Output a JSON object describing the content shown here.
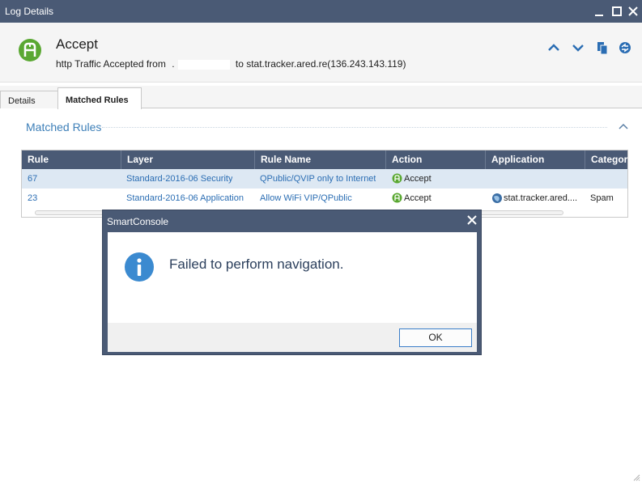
{
  "window": {
    "title": "Log Details",
    "controls": {
      "minimize": "—",
      "maximize": "▢",
      "close": "✕"
    }
  },
  "header": {
    "action_title": "Accept",
    "summary_prefix": "http Traffic Accepted from",
    "summary_source": ".",
    "summary_suffix": "to stat.tracker.ared.re(136.243.143.119)",
    "icons": [
      "accept-icon",
      "up-arrow-icon",
      "down-arrow-icon",
      "copy-icon",
      "refresh-icon"
    ]
  },
  "tabs": [
    {
      "label": "Details",
      "active": false
    },
    {
      "label": "Matched Rules",
      "active": true
    }
  ],
  "section": {
    "title": "Matched Rules"
  },
  "grid": {
    "columns": [
      "Rule",
      "Layer",
      "Rule Name",
      "Action",
      "Application",
      "Category"
    ],
    "rows": [
      {
        "rule": "67",
        "layer": "Standard-2016-06 Security",
        "rule_name": "QPublic/QVIP only to Internet",
        "action": "Accept",
        "application": "",
        "category": ""
      },
      {
        "rule": "23",
        "layer": "Standard-2016-06 Application",
        "rule_name": "Allow WiFi VIP/QPublic",
        "action": "Accept",
        "application": "stat.tracker.ared....",
        "category": "Spam"
      }
    ]
  },
  "dialog": {
    "title": "SmartConsole",
    "message": "Failed to perform navigation.",
    "ok_label": "OK",
    "icon": "info-icon"
  },
  "colors": {
    "titlebar": "#4a5a75",
    "accent_link": "#2a6db3",
    "accept_green": "#5aa832",
    "info_blue": "#3b8ad0"
  }
}
